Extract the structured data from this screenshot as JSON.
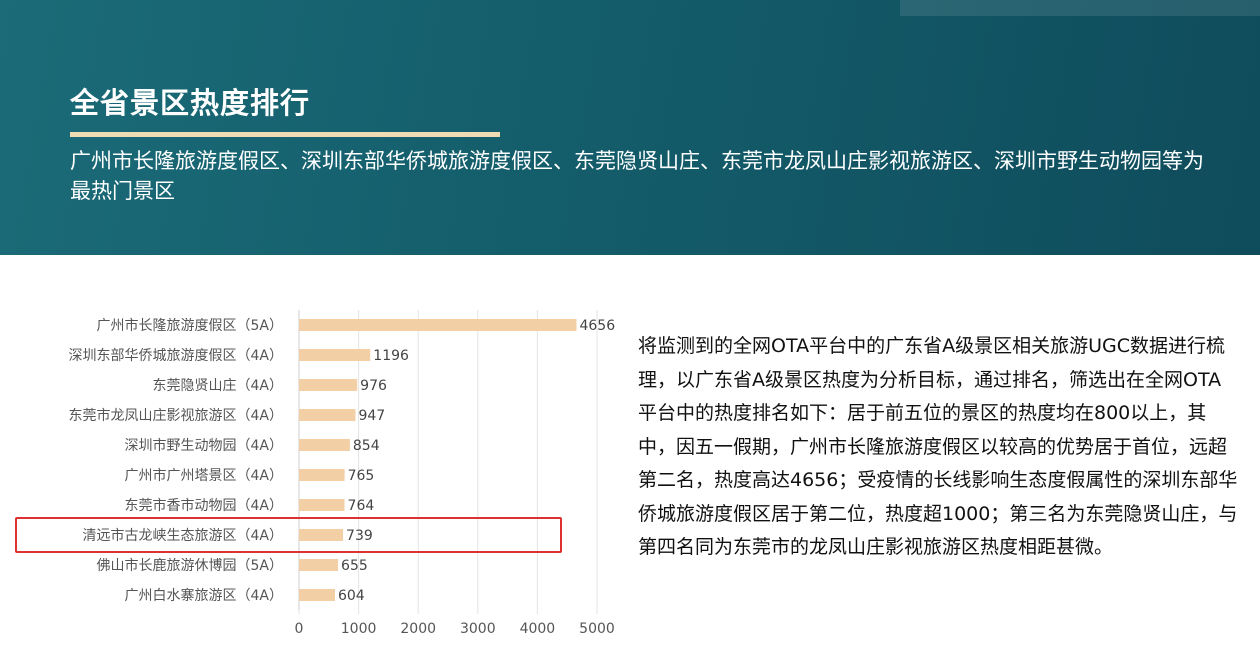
{
  "header": {
    "title": "全省景区热度排行",
    "subtitle": "广州市长隆旅游度假区、深圳东部华侨城旅游度假区、东莞隐贤山庄、东莞市龙凤山庄影视旅游区、深圳市野生动物园等为最热门景区"
  },
  "chart_data": {
    "type": "bar",
    "orientation": "horizontal",
    "categories": [
      "广州市长隆旅游度假区（5A）",
      "深圳东部华侨城旅游度假区（4A）",
      "东莞隐贤山庄（4A）",
      "东莞市龙凤山庄影视旅游区（4A）",
      "深圳市野生动物园（4A）",
      "广州市广州塔景区（4A）",
      "东莞市香市动物园（4A）",
      "清远市古龙峡生态旅游区（4A）",
      "佛山市长鹿旅游休博园（5A）",
      "广州白水寨旅游区（4A）"
    ],
    "values": [
      4656,
      1196,
      976,
      947,
      854,
      765,
      764,
      739,
      655,
      604
    ],
    "xlim": [
      0,
      5000
    ],
    "xticks": [
      0,
      1000,
      2000,
      3000,
      4000,
      5000
    ],
    "grid": true,
    "bar_color": "#f2cfa4",
    "highlight_index": 7,
    "highlight_color": "#e03131"
  },
  "description": "将监测到的全网OTA平台中的广东省A级景区相关旅游UGC数据进行梳理，以广东省A级景区热度为分析目标，通过排名，筛选出在全网OTA平台中的热度排名如下：居于前五位的景区的热度均在800以上，其中，因五一假期，广州市长隆旅游度假区以较高的优势居于首位，远超第二名，热度高达4656；受疫情的长线影响生态度假属性的深圳东部华侨城旅游度假区居于第二位，热度超1000；第三名为东莞隐贤山庄，与第四名同为东莞市的龙凤山庄影视旅游区热度相距甚微。"
}
